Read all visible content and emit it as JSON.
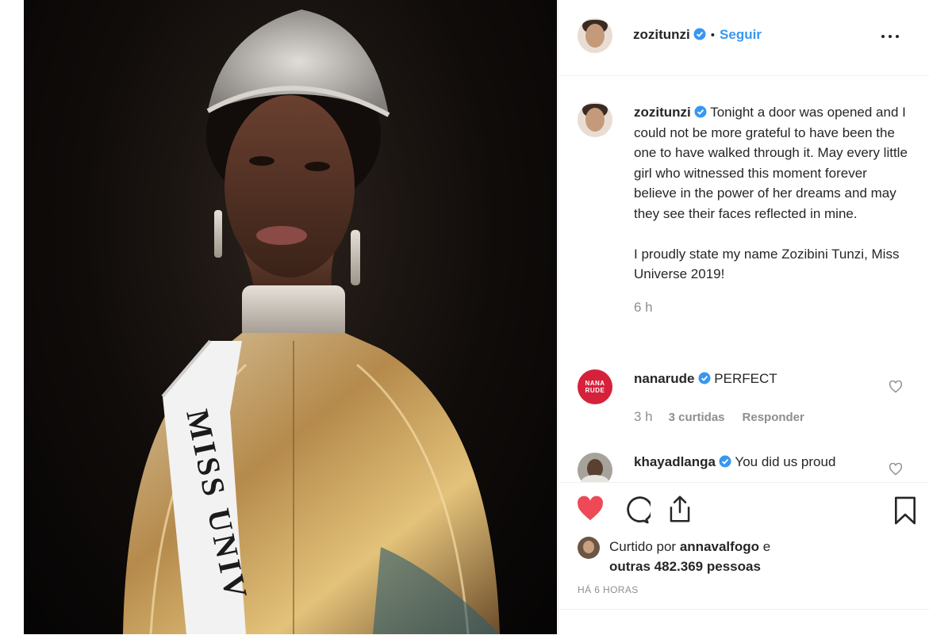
{
  "post": {
    "username": "zozitunzi",
    "follow_label": "Seguir",
    "separator": "•",
    "caption_line1": "Tonight a door was opened and I could not be more grateful to have been the one to have walked through it. May every little girl who witnessed this moment forever believe in the power of her dreams and may they see their faces reflected in mine.",
    "caption_line2": "I proudly state my name Zozibini Tunzi, Miss Universe 2019!",
    "caption_time": "6 h",
    "sash_text": "MISS UNIV"
  },
  "comments": [
    {
      "username": "nanarude",
      "avatar_text": "NANA RUDE",
      "text": "PERFECT",
      "time": "3 h",
      "likes": "3 curtidas",
      "reply_label": "Responder"
    },
    {
      "username": "khayadlanga",
      "text": "You did us proud"
    }
  ],
  "likes": {
    "prefix": "Curtido por",
    "liker": "annavalfogo",
    "conj": "e",
    "others": "outras 482.369 pessoas"
  },
  "posted_ago": "HÁ 6 HORAS",
  "colors": {
    "accent": "#3897f0",
    "like_red": "#ed4956",
    "verified": "#3897f0",
    "muted": "#8e8e8e"
  },
  "icons": [
    "more-options-icon",
    "verified-badge-icon",
    "heart-icon",
    "comment-icon",
    "share-icon",
    "bookmark-icon"
  ]
}
